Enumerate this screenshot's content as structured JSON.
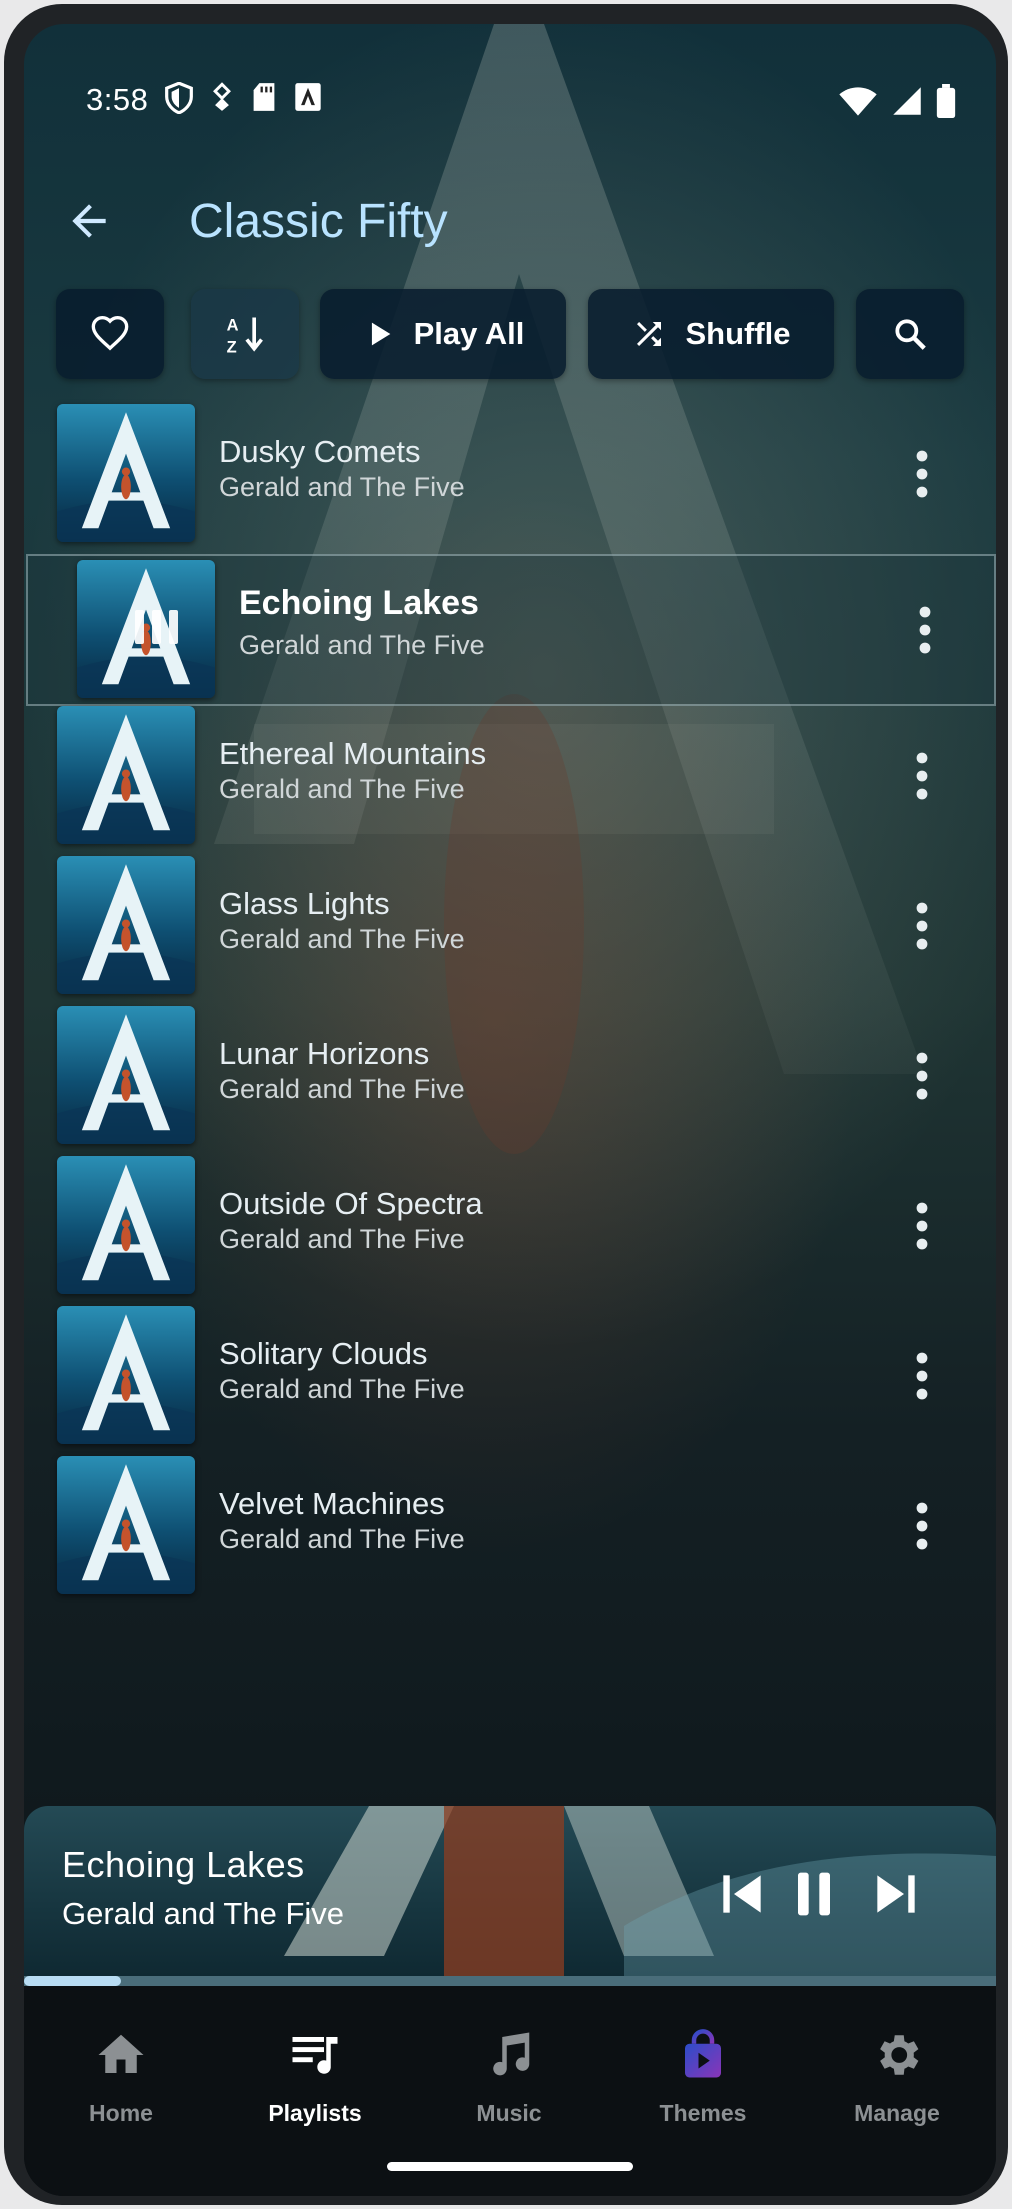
{
  "status_bar": {
    "time": "3:58"
  },
  "header": {
    "title": "Classic Fifty"
  },
  "actions": {
    "play_all_label": "Play All",
    "shuffle_label": "Shuffle"
  },
  "tracks": [
    {
      "title": "Dusky Comets",
      "artist": "Gerald and The Five"
    },
    {
      "title": "Echoing Lakes",
      "artist": "Gerald and The Five",
      "playing": true
    },
    {
      "title": "Ethereal Mountains",
      "artist": "Gerald and The Five"
    },
    {
      "title": "Glass Lights",
      "artist": "Gerald and The Five"
    },
    {
      "title": "Lunar Horizons",
      "artist": "Gerald and The Five"
    },
    {
      "title": "Outside Of Spectra",
      "artist": "Gerald and The Five"
    },
    {
      "title": "Solitary Clouds",
      "artist": "Gerald and The Five"
    },
    {
      "title": "Velvet Machines",
      "artist": "Gerald and The Five"
    }
  ],
  "now_playing": {
    "title": "Echoing Lakes",
    "artist": "Gerald and The Five",
    "progress_fraction": 0.1
  },
  "bottom_nav": {
    "items": [
      {
        "label": "Home",
        "icon": "home-icon"
      },
      {
        "label": "Playlists",
        "icon": "playlist-icon",
        "active": true
      },
      {
        "label": "Music",
        "icon": "music-note-icon"
      },
      {
        "label": "Themes",
        "icon": "shopping-bag-icon"
      },
      {
        "label": "Manage",
        "icon": "gear-icon"
      }
    ]
  },
  "colors": {
    "title": "#b9e3ff",
    "progress": "#b8dcf3",
    "themes_icon_gradient": [
      "#2c4dc9",
      "#8a35b8"
    ]
  }
}
